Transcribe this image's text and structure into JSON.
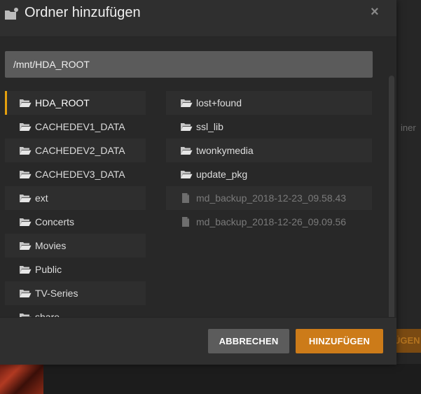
{
  "dialog": {
    "title": "Ordner hinzufügen",
    "close_glyph": "×",
    "path_value": "/mnt/HDA_ROOT"
  },
  "left_list": [
    {
      "label": "HDA_ROOT",
      "selected": true
    },
    {
      "label": "CACHEDEV1_DATA"
    },
    {
      "label": "CACHEDEV2_DATA"
    },
    {
      "label": "CACHEDEV3_DATA"
    },
    {
      "label": "ext"
    },
    {
      "label": "Concerts"
    },
    {
      "label": "Movies"
    },
    {
      "label": "Public"
    },
    {
      "label": "TV-Series"
    },
    {
      "label": "share"
    }
  ],
  "right_list": [
    {
      "label": "lost+found",
      "type": "folder"
    },
    {
      "label": "ssl_lib",
      "type": "folder"
    },
    {
      "label": "twonkymedia",
      "type": "folder"
    },
    {
      "label": "update_pkg",
      "type": "folder"
    },
    {
      "label": "md_backup_2018-12-23_09.58.43",
      "type": "file"
    },
    {
      "label": "md_backup_2018-12-26_09.09.56",
      "type": "file"
    }
  ],
  "footer": {
    "cancel_label": "ABBRECHEN",
    "add_label": "HINZUFÜGEN"
  },
  "background": {
    "peek_text": "iner",
    "peek_button": "ÜGEN"
  },
  "colors": {
    "accent": "#e5a00d",
    "add_button": "#cc7b19",
    "cancel_button": "#5c5c5c",
    "input_bg": "#5b5b5b",
    "modal_bg": "#282828"
  },
  "icons": {
    "title": "folder-add-icon",
    "folder": "folder-open-icon",
    "file": "file-icon",
    "close": "close-icon"
  }
}
